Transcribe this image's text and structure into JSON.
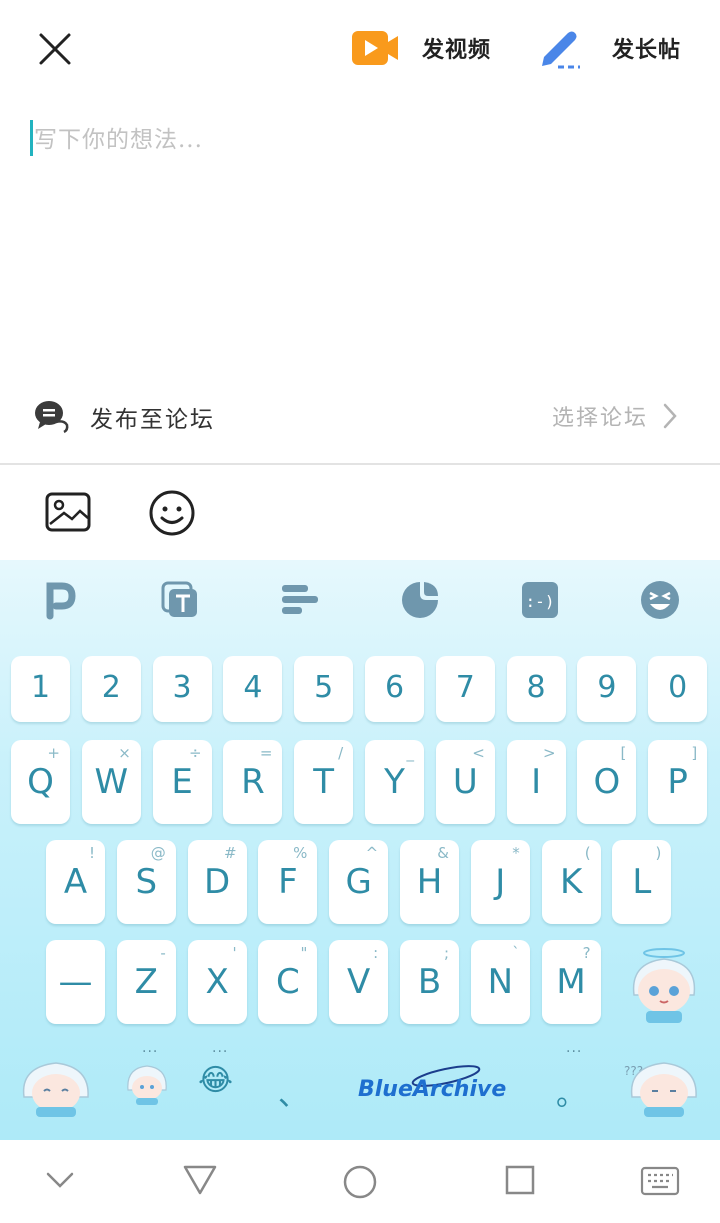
{
  "header": {
    "close_icon": "close-icon",
    "video_label": "发视频",
    "long_post_label": "发长帖",
    "accent_orange": "#f99a1c",
    "accent_blue": "#4a86e8"
  },
  "compose": {
    "placeholder": "写下你的想法..."
  },
  "forum": {
    "label": "发布至论坛",
    "select_label": "选择论坛"
  },
  "media_bar": {
    "icons": [
      "image-icon",
      "emoji-icon"
    ]
  },
  "keyboard": {
    "toolbar_icons": [
      "p-logo-icon",
      "text-icon",
      "align-icon",
      "sticker-icon",
      "kaomoji-icon",
      "emoji-face-icon"
    ],
    "number_row": [
      "1",
      "2",
      "3",
      "4",
      "5",
      "6",
      "7",
      "8",
      "9",
      "0"
    ],
    "row1": [
      {
        "key": "Q",
        "sub": "+"
      },
      {
        "key": "W",
        "sub": "×"
      },
      {
        "key": "E",
        "sub": "÷"
      },
      {
        "key": "R",
        "sub": "="
      },
      {
        "key": "T",
        "sub": "/"
      },
      {
        "key": "Y",
        "sub": "_"
      },
      {
        "key": "U",
        "sub": "<"
      },
      {
        "key": "I",
        "sub": ">"
      },
      {
        "key": "O",
        "sub": "["
      },
      {
        "key": "P",
        "sub": "]"
      }
    ],
    "row2": [
      {
        "key": "A",
        "sub": "!"
      },
      {
        "key": "S",
        "sub": "@"
      },
      {
        "key": "D",
        "sub": "#"
      },
      {
        "key": "F",
        "sub": "%"
      },
      {
        "key": "G",
        "sub": "^"
      },
      {
        "key": "H",
        "sub": "&"
      },
      {
        "key": "J",
        "sub": "*"
      },
      {
        "key": "K",
        "sub": "("
      },
      {
        "key": "L",
        "sub": ")"
      }
    ],
    "row3": [
      {
        "key": "—",
        "sub": ""
      },
      {
        "key": "Z",
        "sub": "-"
      },
      {
        "key": "X",
        "sub": "'"
      },
      {
        "key": "C",
        "sub": "\""
      },
      {
        "key": "V",
        "sub": ":"
      },
      {
        "key": "B",
        "sub": ";"
      },
      {
        "key": "N",
        "sub": "`"
      },
      {
        "key": "M",
        "sub": "?"
      }
    ],
    "bottom": {
      "comma": "、",
      "period": "。",
      "brand": "BlueArchive",
      "emoji": "😂",
      "dots": "..."
    },
    "bg_color": "#c9f1fb",
    "key_text_color": "#2f8ca6"
  },
  "navbar": {
    "icons": [
      "collapse-keyboard-icon",
      "back-icon",
      "home-icon",
      "recents-icon",
      "keyboard-switch-icon"
    ]
  }
}
